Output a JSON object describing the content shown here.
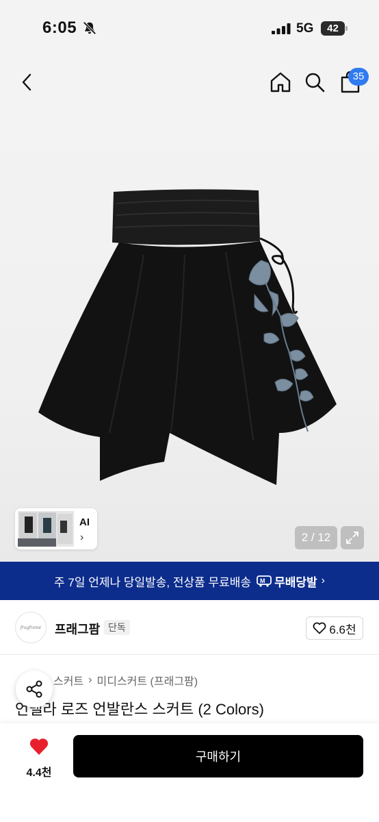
{
  "status_bar": {
    "time": "6:05",
    "network": "5G",
    "battery": "42"
  },
  "nav": {
    "cart_count": "35"
  },
  "gallery": {
    "ai_label": "AI",
    "page_indicator": "2 / 12"
  },
  "delivery_banner": {
    "text": "주 7일 언제나 당일발송, 전상품 무료배송",
    "brand": "무배당발"
  },
  "brand": {
    "name": "프래그팜",
    "tag": "단독",
    "likes": "6.6천",
    "logo_text": "fragframe"
  },
  "breadcrumb": [
    "스커트",
    "미디스커트 (프래그팜)"
  ],
  "product": {
    "title": "언밸라 로즈 언발란스 스커트 (2 Colors)"
  },
  "bottom_bar": {
    "wish_count": "4.4천",
    "buy_label": "구매하기"
  },
  "colors": {
    "banner_bg": "#0d2d8c",
    "badge": "#2f7bf0",
    "heart": "#e8202e"
  }
}
